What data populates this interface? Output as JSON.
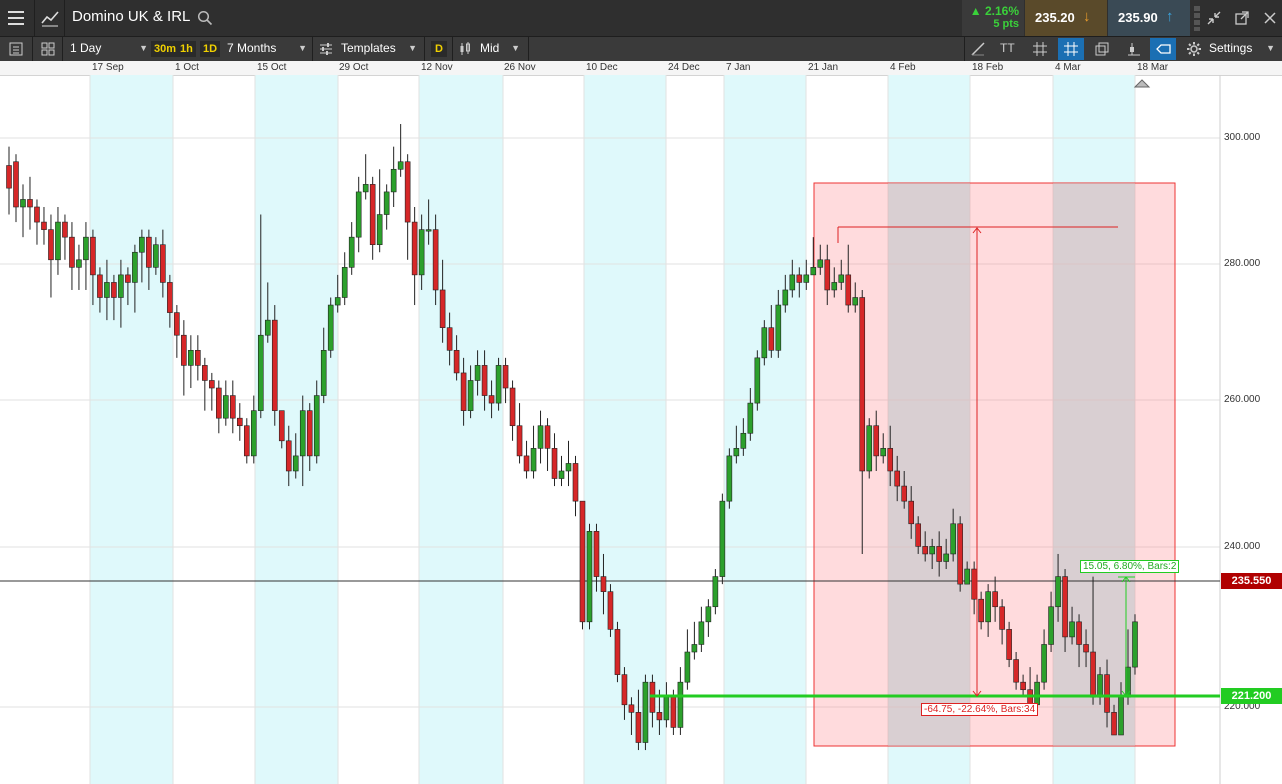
{
  "header": {
    "instrument": "Domino UK & IRL",
    "change_pct": "▲ 2.16%",
    "change_pts": "5 pts",
    "sell_price": "235.20",
    "buy_price": "235.90",
    "sell_arrow": "↓",
    "buy_arrow": "↑"
  },
  "toolbar": {
    "interval": "1 Day",
    "quick_intervals": [
      "30m",
      "1h",
      "1D"
    ],
    "range": "7 Months",
    "templates": "Templates",
    "d_button": "D",
    "price_type": "Mid",
    "settings": "Settings",
    "font_tool": "TT"
  },
  "time_axis": [
    "17 Sep",
    "1 Oct",
    "15 Oct",
    "29 Oct",
    "12 Nov",
    "26 Nov",
    "10 Dec",
    "24 Dec",
    "7 Jan",
    "21 Jan",
    "4 Feb",
    "18 Feb",
    "4 Mar",
    "18 Mar"
  ],
  "price_axis": [
    "300.000",
    "280.000",
    "260.000",
    "240.000",
    "220.000"
  ],
  "tags": {
    "current": "235.550",
    "line": "221.200"
  },
  "measurements": {
    "big": "-64.75, -22.64%, Bars:34",
    "small": "15.05, 6.80%, Bars:2"
  },
  "colors": {
    "up": "#2ca02c",
    "down": "#d62728",
    "sell_bg": "#5a4a2a",
    "buy_bg": "#3a4a55",
    "accent_green": "#22cc22",
    "tag_red": "#b00000"
  },
  "chart_data": {
    "type": "candlestick",
    "ylim": [
      214.5,
      308.5
    ],
    "x_first": "2018-08-29",
    "x_last": "2019-03-19",
    "candles": [
      [
        296.5,
        293.5,
        299,
        290
      ],
      [
        297,
        291,
        298,
        289
      ],
      [
        291,
        292,
        294,
        287
      ],
      [
        292,
        291,
        295,
        288
      ],
      [
        291,
        289,
        292,
        286
      ],
      [
        289,
        288,
        291,
        286
      ],
      [
        288,
        284,
        290,
        279
      ],
      [
        284,
        289,
        291,
        282
      ],
      [
        289,
        287,
        290,
        284
      ],
      [
        287,
        283,
        289,
        280
      ],
      [
        283,
        284,
        286,
        280
      ],
      [
        284,
        287,
        289,
        280
      ],
      [
        287,
        282,
        288,
        278
      ],
      [
        282,
        279,
        283,
        277
      ],
      [
        279,
        281,
        284,
        276
      ],
      [
        281,
        279,
        282,
        276
      ],
      [
        279,
        282,
        284,
        275
      ],
      [
        282,
        281,
        283,
        278
      ],
      [
        281,
        285,
        286,
        277
      ],
      [
        285,
        287,
        288,
        281
      ],
      [
        287,
        283,
        288,
        280
      ],
      [
        283,
        286,
        287,
        282
      ],
      [
        286,
        281,
        288,
        279
      ],
      [
        281,
        277,
        282,
        275
      ],
      [
        277,
        274,
        278,
        271
      ],
      [
        274,
        270,
        276,
        266
      ],
      [
        270,
        272,
        274,
        267
      ],
      [
        272,
        270,
        274,
        268
      ],
      [
        270,
        268,
        271,
        264
      ],
      [
        268,
        267,
        269,
        264
      ],
      [
        267,
        263,
        268,
        261
      ],
      [
        263,
        266,
        268,
        262
      ],
      [
        266,
        263,
        268,
        261
      ],
      [
        263,
        262,
        265,
        260
      ],
      [
        262,
        258,
        263,
        257
      ],
      [
        258,
        264,
        266,
        257
      ],
      [
        264,
        274,
        290,
        263
      ],
      [
        274,
        276,
        281,
        273
      ],
      [
        276,
        264,
        278,
        262
      ],
      [
        264,
        260,
        264,
        259
      ],
      [
        260,
        256,
        262,
        254
      ],
      [
        256,
        258,
        261,
        255
      ],
      [
        258,
        264,
        266,
        254
      ],
      [
        264,
        258,
        265,
        256
      ],
      [
        258,
        266,
        268,
        257
      ],
      [
        266,
        272,
        275,
        265
      ],
      [
        272,
        278,
        279,
        271
      ],
      [
        278,
        279,
        282,
        277
      ],
      [
        279,
        283,
        285,
        278
      ],
      [
        283,
        287,
        289,
        282
      ],
      [
        287,
        293,
        295,
        285
      ],
      [
        293,
        294,
        298,
        292
      ],
      [
        294,
        286,
        295,
        284
      ],
      [
        286,
        290,
        296,
        285
      ],
      [
        290,
        293,
        294,
        288
      ],
      [
        293,
        296,
        299,
        291
      ],
      [
        296,
        297,
        302,
        295
      ],
      [
        297,
        289,
        298,
        284
      ],
      [
        289,
        282,
        291,
        278
      ],
      [
        282,
        288,
        290,
        280
      ],
      [
        288,
        288,
        292,
        286
      ],
      [
        288,
        280,
        290,
        278
      ],
      [
        280,
        275,
        284,
        273
      ],
      [
        275,
        272,
        277,
        270
      ],
      [
        272,
        269,
        274,
        268
      ],
      [
        269,
        264,
        271,
        262
      ],
      [
        264,
        268,
        270,
        263
      ],
      [
        268,
        270,
        272,
        266
      ],
      [
        270,
        266,
        272,
        264
      ],
      [
        266,
        265,
        268,
        263
      ],
      [
        265,
        270,
        271,
        264
      ],
      [
        270,
        267,
        271,
        265
      ],
      [
        267,
        262,
        268,
        260
      ],
      [
        262,
        258,
        265,
        257
      ],
      [
        258,
        256,
        260,
        255
      ],
      [
        256,
        259,
        262,
        255
      ],
      [
        259,
        262,
        264,
        257
      ],
      [
        262,
        259,
        263,
        256
      ],
      [
        259,
        255,
        261,
        254
      ],
      [
        255,
        256,
        258,
        254
      ],
      [
        256,
        257,
        260,
        254
      ],
      [
        257,
        252,
        258,
        250
      ],
      [
        252,
        236,
        252,
        235
      ],
      [
        236,
        248,
        249,
        235
      ],
      [
        248,
        242,
        249,
        240
      ],
      [
        242,
        240,
        245,
        237
      ],
      [
        240,
        235,
        241,
        234
      ],
      [
        235,
        229,
        236,
        228
      ],
      [
        229,
        225,
        230,
        223
      ],
      [
        225,
        224,
        226,
        221
      ],
      [
        224,
        220,
        227,
        219
      ],
      [
        220,
        228,
        229,
        219
      ],
      [
        228,
        224,
        229,
        222
      ],
      [
        224,
        223,
        227,
        221
      ],
      [
        223,
        226,
        228,
        222
      ],
      [
        226,
        222,
        227,
        221
      ],
      [
        222,
        228,
        230,
        221
      ],
      [
        228,
        232,
        235,
        227
      ],
      [
        232,
        233,
        236,
        231
      ],
      [
        233,
        236,
        238,
        232
      ],
      [
        236,
        238,
        239,
        234
      ],
      [
        238,
        242,
        243,
        237
      ],
      [
        242,
        252,
        253,
        241
      ],
      [
        252,
        258,
        259,
        251
      ],
      [
        258,
        259,
        262,
        257
      ],
      [
        259,
        261,
        263,
        258
      ],
      [
        261,
        265,
        267,
        260
      ],
      [
        265,
        271,
        272,
        264
      ],
      [
        271,
        275,
        276,
        270
      ],
      [
        275,
        272,
        278,
        271
      ],
      [
        272,
        278,
        280,
        271
      ],
      [
        278,
        280,
        282,
        277
      ],
      [
        280,
        282,
        284,
        279
      ],
      [
        282,
        281,
        283,
        279
      ],
      [
        281,
        282,
        284,
        280
      ],
      [
        282,
        283,
        287,
        282
      ],
      [
        283,
        284,
        286,
        282
      ],
      [
        284,
        280,
        286,
        278
      ],
      [
        280,
        281,
        283,
        279
      ],
      [
        281,
        282,
        284,
        280
      ],
      [
        282,
        278,
        286,
        277
      ],
      [
        278,
        279,
        281,
        277
      ],
      [
        279,
        256,
        280,
        245
      ],
      [
        256,
        262,
        263,
        255
      ],
      [
        262,
        258,
        264,
        256
      ],
      [
        258,
        259,
        261,
        257
      ],
      [
        259,
        256,
        262,
        254
      ],
      [
        256,
        254,
        258,
        252
      ],
      [
        254,
        252,
        256,
        251
      ],
      [
        252,
        249,
        254,
        247
      ],
      [
        249,
        246,
        250,
        245
      ],
      [
        246,
        245,
        248,
        244
      ],
      [
        245,
        246,
        247,
        243
      ],
      [
        246,
        244,
        248,
        242
      ],
      [
        244,
        245,
        247,
        243
      ],
      [
        245,
        249,
        251,
        244
      ],
      [
        249,
        241,
        250,
        240
      ],
      [
        241,
        243,
        244,
        241
      ],
      [
        243,
        239,
        244,
        237
      ],
      [
        239,
        236,
        240,
        235
      ],
      [
        236,
        240,
        241,
        234
      ],
      [
        240,
        238,
        242,
        236
      ],
      [
        238,
        235,
        239,
        233
      ],
      [
        235,
        231,
        236,
        230
      ],
      [
        231,
        228,
        232,
        227
      ],
      [
        228,
        227,
        229,
        226
      ],
      [
        227,
        225,
        230,
        224
      ],
      [
        225,
        228,
        229,
        224
      ],
      [
        228,
        233,
        235,
        227
      ],
      [
        233,
        238,
        240,
        232
      ],
      [
        238,
        242,
        245,
        236
      ],
      [
        242,
        234,
        243,
        232
      ],
      [
        234,
        236,
        238,
        233
      ],
      [
        236,
        233,
        237,
        230
      ],
      [
        233,
        232,
        235,
        230
      ],
      [
        232,
        226,
        242,
        225
      ],
      [
        226,
        229,
        230,
        225
      ],
      [
        229,
        224,
        231,
        222
      ],
      [
        224,
        221,
        225,
        221
      ],
      [
        221,
        226,
        228,
        222
      ],
      [
        226,
        230,
        235,
        225
      ],
      [
        230,
        236,
        237,
        229
      ]
    ]
  }
}
